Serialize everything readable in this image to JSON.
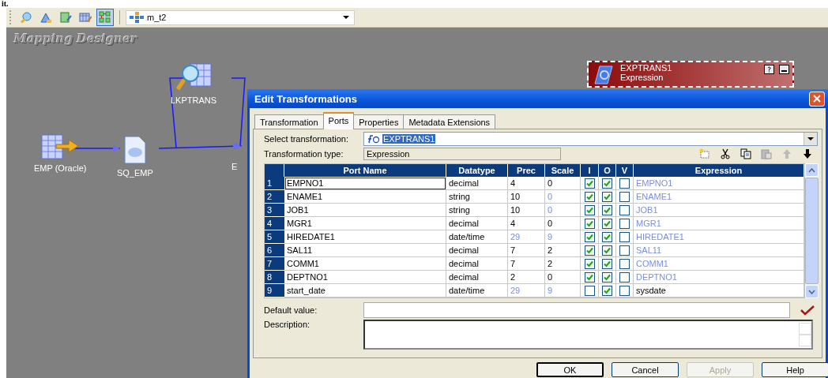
{
  "page_fragment": "it.",
  "toolbar": {
    "buttons": [
      {
        "selected": false
      },
      {
        "selected": false
      },
      {
        "selected": false
      },
      {
        "selected": false
      },
      {
        "selected": true
      }
    ],
    "mapping": "m_t2"
  },
  "canvas": {
    "title": "Mapping Designer",
    "nodes": [
      {
        "kind": "source",
        "label": "EMP (Oracle)"
      },
      {
        "kind": "qualifier",
        "label": "SQ_EMP"
      },
      {
        "kind": "lookup",
        "label": "LKPTRANS"
      },
      {
        "kind": "hidden",
        "label": "E"
      }
    ],
    "expression_node": {
      "name": "EXPTRANS1",
      "type": "Expression",
      "selected": true
    }
  },
  "dialog": {
    "title": "Edit Transformations",
    "tabs": [
      {
        "label": "Transformation",
        "selected": false
      },
      {
        "label": "Ports",
        "selected": true
      },
      {
        "label": "Properties",
        "selected": false
      },
      {
        "label": "Metadata Extensions",
        "selected": false
      }
    ],
    "select_label": "Select transformation:",
    "select_value": "EXPTRANS1",
    "type_label": "Transformation type:",
    "type_value": "Expression",
    "columns": [
      "Port Name",
      "Datatype",
      "Prec",
      "Scale",
      "I",
      "O",
      "V",
      "Expression"
    ],
    "rows": [
      {
        "num": "1",
        "name": "EMPNO1",
        "datatype": "decimal",
        "prec": "4",
        "prec_disabled": false,
        "scale": "0",
        "scale_disabled": false,
        "input": true,
        "output": true,
        "variable": false,
        "expression": "EMPNO1",
        "expression_disabled": true,
        "focused": true
      },
      {
        "num": "2",
        "name": "ENAME1",
        "datatype": "string",
        "prec": "10",
        "prec_disabled": false,
        "scale": "0",
        "scale_disabled": true,
        "input": true,
        "output": true,
        "variable": false,
        "expression": "ENAME1",
        "expression_disabled": true,
        "focused": false
      },
      {
        "num": "3",
        "name": "JOB1",
        "datatype": "string",
        "prec": "10",
        "prec_disabled": false,
        "scale": "0",
        "scale_disabled": true,
        "input": true,
        "output": true,
        "variable": false,
        "expression": "JOB1",
        "expression_disabled": true,
        "focused": false
      },
      {
        "num": "4",
        "name": "MGR1",
        "datatype": "decimal",
        "prec": "4",
        "prec_disabled": false,
        "scale": "0",
        "scale_disabled": false,
        "input": true,
        "output": true,
        "variable": false,
        "expression": "MGR1",
        "expression_disabled": true,
        "focused": false
      },
      {
        "num": "5",
        "name": "HIREDATE1",
        "datatype": "date/time",
        "prec": "29",
        "prec_disabled": true,
        "scale": "9",
        "scale_disabled": true,
        "input": true,
        "output": true,
        "variable": false,
        "expression": "HIREDATE1",
        "expression_disabled": true,
        "focused": false
      },
      {
        "num": "6",
        "name": "SAL11",
        "datatype": "decimal",
        "prec": "7",
        "prec_disabled": false,
        "scale": "2",
        "scale_disabled": false,
        "input": true,
        "output": true,
        "variable": false,
        "expression": "SAL11",
        "expression_disabled": true,
        "focused": false
      },
      {
        "num": "7",
        "name": "COMM1",
        "datatype": "decimal",
        "prec": "7",
        "prec_disabled": false,
        "scale": "2",
        "scale_disabled": false,
        "input": true,
        "output": true,
        "variable": false,
        "expression": "COMM1",
        "expression_disabled": true,
        "focused": false
      },
      {
        "num": "8",
        "name": "DEPTNO1",
        "datatype": "decimal",
        "prec": "2",
        "prec_disabled": false,
        "scale": "0",
        "scale_disabled": false,
        "input": true,
        "output": true,
        "variable": false,
        "expression": "DEPTNO1",
        "expression_disabled": true,
        "focused": false
      },
      {
        "num": "9",
        "name": "start_date",
        "datatype": "date/time",
        "prec": "29",
        "prec_disabled": true,
        "scale": "9",
        "scale_disabled": true,
        "input": false,
        "output": true,
        "variable": false,
        "expression": "sysdate",
        "expression_disabled": false,
        "focused": false
      }
    ],
    "default_label": "Default value:",
    "description_label": "Description:",
    "buttons": [
      {
        "label": "OK",
        "disabled": false
      },
      {
        "label": "Cancel",
        "disabled": false
      },
      {
        "label": "Apply",
        "disabled": true
      },
      {
        "label": "Help",
        "disabled": false
      }
    ]
  }
}
